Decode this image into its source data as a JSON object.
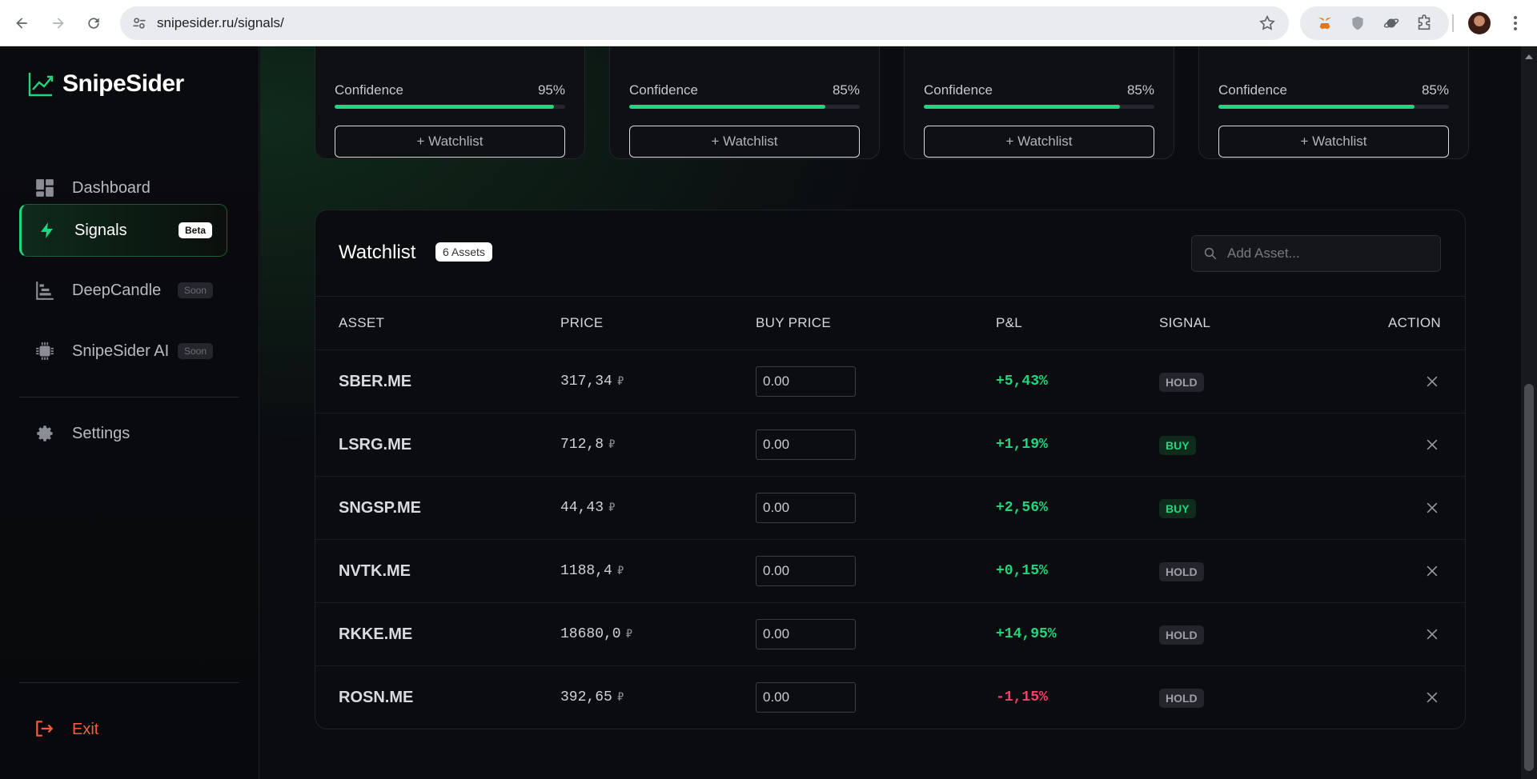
{
  "browser": {
    "url": "snipesider.ru/signals/"
  },
  "sidebar": {
    "brand": "SnipeSider",
    "items": [
      {
        "label": "Dashboard",
        "icon": "dashboard-icon"
      },
      {
        "label": "Signals",
        "icon": "bolt-icon",
        "tag": "Beta",
        "active": true
      },
      {
        "label": "DeepCandle",
        "icon": "candles-icon",
        "tag": "Soon"
      },
      {
        "label": "SnipeSider AI",
        "icon": "chip-icon",
        "tag": "Soon"
      },
      {
        "label": "Settings",
        "icon": "gear-icon"
      }
    ],
    "exit_label": "Exit"
  },
  "signal_cards": [
    {
      "confidence_label": "Confidence",
      "confidence": "95%",
      "confidence_value": 95,
      "watchlist_button": "+ Watchlist"
    },
    {
      "confidence_label": "Confidence",
      "confidence": "85%",
      "confidence_value": 85,
      "watchlist_button": "+ Watchlist"
    },
    {
      "confidence_label": "Confidence",
      "confidence": "85%",
      "confidence_value": 85,
      "watchlist_button": "+ Watchlist"
    },
    {
      "confidence_label": "Confidence",
      "confidence": "85%",
      "confidence_value": 85,
      "watchlist_button": "+ Watchlist"
    }
  ],
  "watchlist": {
    "title": "Watchlist",
    "count": "6 Assets",
    "search_placeholder": "Add Asset...",
    "columns": {
      "asset": "ASSET",
      "price": "PRICE",
      "buy_price": "BUY PRICE",
      "pnl": "P&L",
      "signal": "SIGNAL",
      "action": "ACTION"
    },
    "currency": "₽",
    "rows": [
      {
        "asset": "SBER.ME",
        "price": "317,34",
        "buy_price": "0.00",
        "pnl": "+5,43%",
        "pnl_positive": true,
        "signal": "HOLD"
      },
      {
        "asset": "LSRG.ME",
        "price": "712,8",
        "buy_price": "0.00",
        "pnl": "+1,19%",
        "pnl_positive": true,
        "signal": "BUY"
      },
      {
        "asset": "SNGSP.ME",
        "price": "44,43",
        "buy_price": "0.00",
        "pnl": "+2,56%",
        "pnl_positive": true,
        "signal": "BUY"
      },
      {
        "asset": "NVTK.ME",
        "price": "1188,4",
        "buy_price": "0.00",
        "pnl": "+0,15%",
        "pnl_positive": true,
        "signal": "HOLD"
      },
      {
        "asset": "RKKE.ME",
        "price": "18680,0",
        "buy_price": "0.00",
        "pnl": "+14,95%",
        "pnl_positive": true,
        "signal": "HOLD"
      },
      {
        "asset": "ROSN.ME",
        "price": "392,65",
        "buy_price": "0.00",
        "pnl": "-1,15%",
        "pnl_positive": false,
        "signal": "HOLD"
      }
    ]
  },
  "colors": {
    "accent": "#1fd67e",
    "negative": "#ff3b6b",
    "exit": "#ff5a3c"
  }
}
